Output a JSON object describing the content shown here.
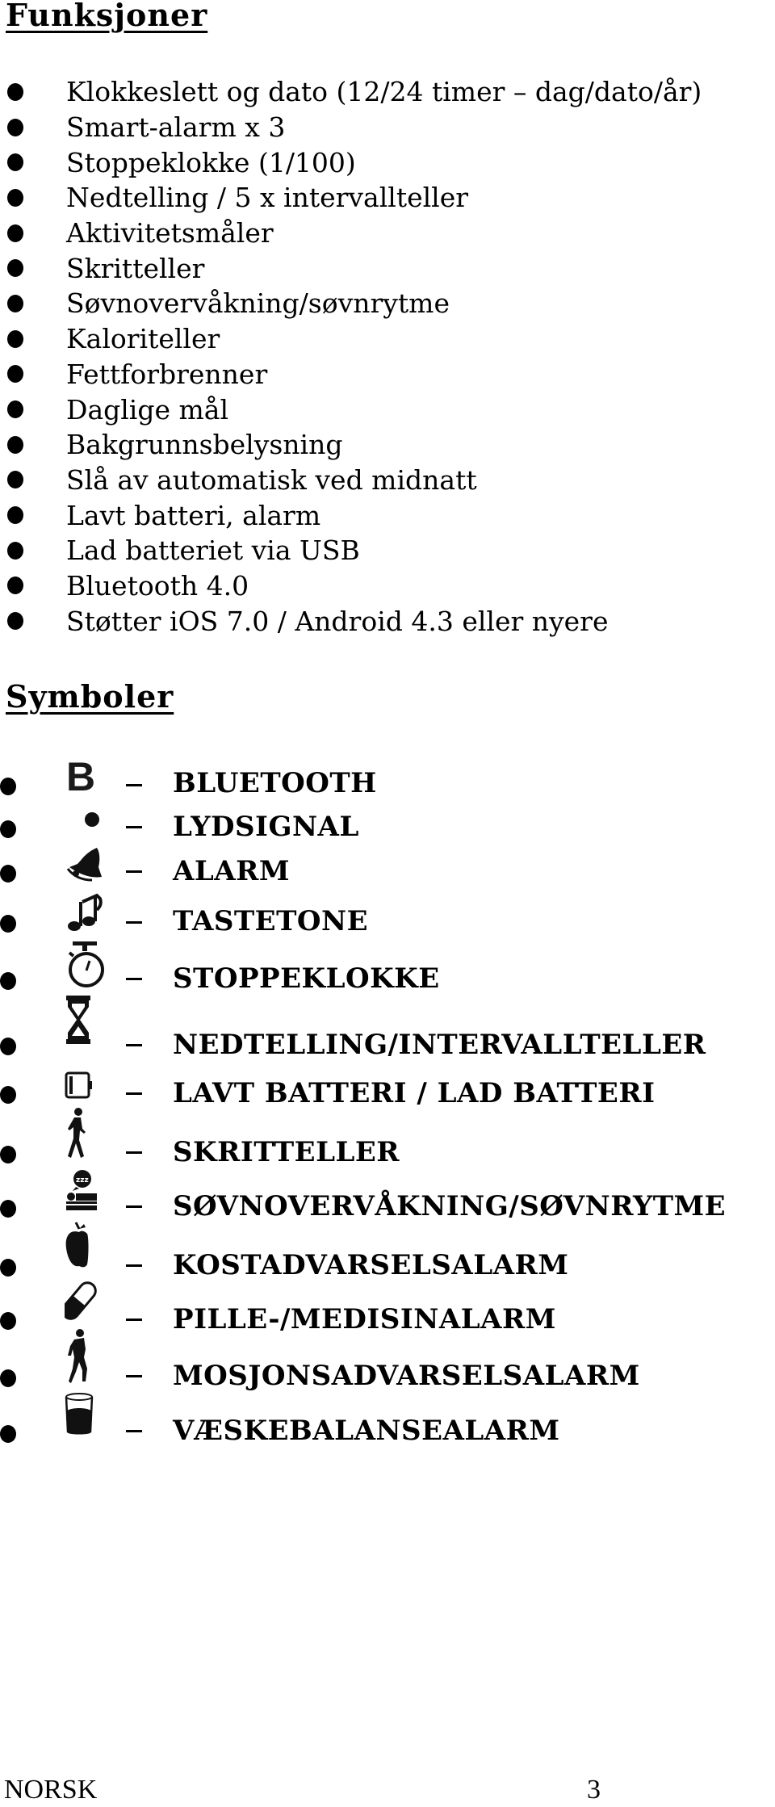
{
  "sections": {
    "functions_heading": "Funksjoner",
    "symbols_heading": "Symboler"
  },
  "features": [
    "Klokkeslett og dato (12/24 timer – dag/dato/år)",
    "Smart-alarm x 3",
    "Stoppeklokke (1/100)",
    "Nedtelling / 5 x intervallteller",
    "Aktivitetsmåler",
    "Skritteller",
    "Søvnovervåkning/søvnrytme",
    "Kaloriteller",
    "Fettforbrenner",
    "Daglige mål",
    "Bakgrunnsbelysning",
    "Slå av automatisk ved midnatt",
    "Lavt batteri, alarm",
    "Lad batteriet via USB",
    "Bluetooth 4.0",
    "Støtter iOS 7.0 / Android 4.3 eller nyere"
  ],
  "symbols": [
    {
      "icon": "bluetooth-icon",
      "glyph": "B",
      "label": "BLUETOOTH"
    },
    {
      "icon": "sound-signal-icon",
      "label": "LYDSIGNAL"
    },
    {
      "icon": "bell-icon",
      "label": "ALARM"
    },
    {
      "icon": "music-note-icon",
      "label": "TASTETONE"
    },
    {
      "icon": "stopwatch-icon",
      "label": "STOPPEKLOKKE"
    },
    {
      "icon": "hourglass-icon",
      "label": "NEDTELLING/INTERVALLTELLER"
    },
    {
      "icon": "battery-low-icon",
      "label": "LAVT BATTERI / LAD BATTERI"
    },
    {
      "icon": "walking-person-icon",
      "label": "SKRITTELLER"
    },
    {
      "icon": "sleep-bed-icon",
      "label": "SØVNOVERVÅKNING/SØVNRYTME"
    },
    {
      "icon": "apple-icon",
      "label": "KOSTADVARSELSALARM"
    },
    {
      "icon": "pill-icon",
      "label": "PILLE-/MEDISINALARM"
    },
    {
      "icon": "running-person-icon",
      "label": "MOSJONSADVARSELSALARM"
    },
    {
      "icon": "water-glass-icon",
      "label": "VÆSKEBALANSEALARM"
    }
  ],
  "footer": {
    "language": "NORSK",
    "page_number": "3"
  }
}
